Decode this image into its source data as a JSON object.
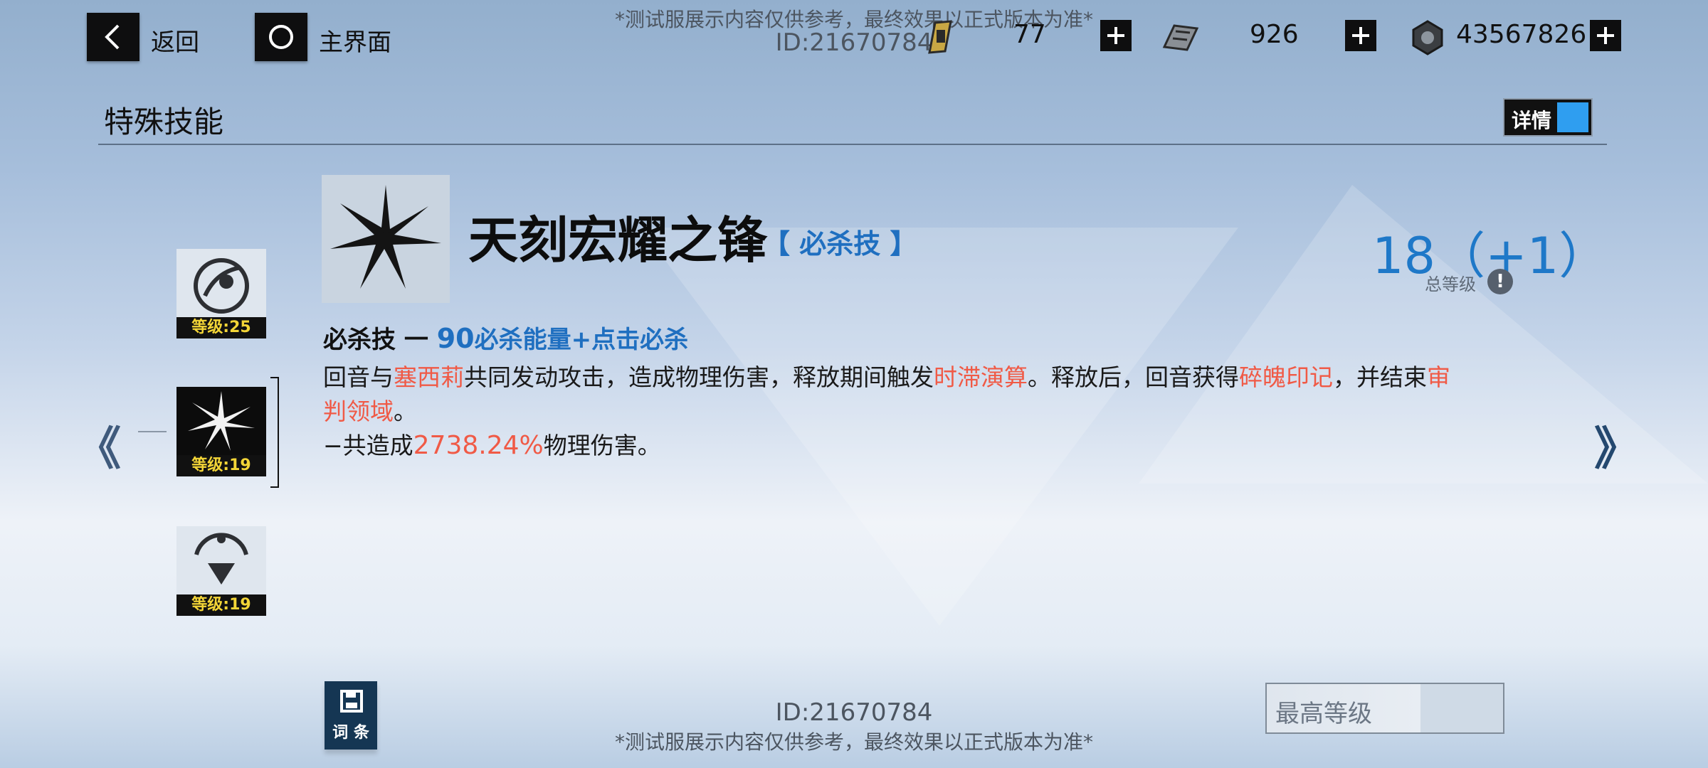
{
  "header": {
    "back_label": "返回",
    "home_label": "主界面",
    "watermark": "*测试服展示内容仅供参考，最终效果以正式版本为准*",
    "user_id": "ID:21670784"
  },
  "resources": [
    {
      "icon": "gold-fuel-icon",
      "value": "77"
    },
    {
      "icon": "data-chip-icon",
      "value": "926"
    },
    {
      "icon": "hex-nut-icon",
      "value": "43567826"
    }
  ],
  "section": {
    "title": "特殊技能",
    "detail_label": "详情"
  },
  "skills": [
    {
      "icon": "skill-emblem-ring-icon",
      "level_text": "等级:25"
    },
    {
      "icon": "skill-emblem-starburst-icon",
      "level_text": "等级:19",
      "selected": true
    },
    {
      "icon": "skill-emblem-triangle-icon",
      "level_text": "等级:19"
    }
  ],
  "selected_skill": {
    "name": "天刻宏耀之锋",
    "tag": "【 必杀技 】",
    "total_level": "18（+1）",
    "total_level_label": "总等级",
    "info_mark": "!",
    "heading_prefix": "必杀技 一 ",
    "heading_num": "90",
    "heading_rest": "必杀能量+点击必杀",
    "desc_line1": {
      "p1": "回音与",
      "r1": "塞西莉",
      "p2": "共同发动攻击，造成物理伤害，释放期间触发",
      "r2": "时滞演算",
      "p3": "。释放后，回音获得",
      "r3": "碎魄印记",
      "p4": "，并结束",
      "r4": "审"
    },
    "desc_line2": {
      "r1": "判领域",
      "p1": "。"
    },
    "desc_line3": {
      "p1": "−共造成",
      "r1": "2738.24%",
      "p2": "物理伤害。"
    }
  },
  "footer": {
    "entry_label": "词 条",
    "max_level_label": "最高等级",
    "user_id": "ID:21670784",
    "watermark": "*测试服展示内容仅供参考，最终效果以正式版本为准*"
  },
  "colors": {
    "accent_blue": "#1f6fc0",
    "highlight_red": "#f05a46",
    "level_yellow": "#f3d537"
  }
}
